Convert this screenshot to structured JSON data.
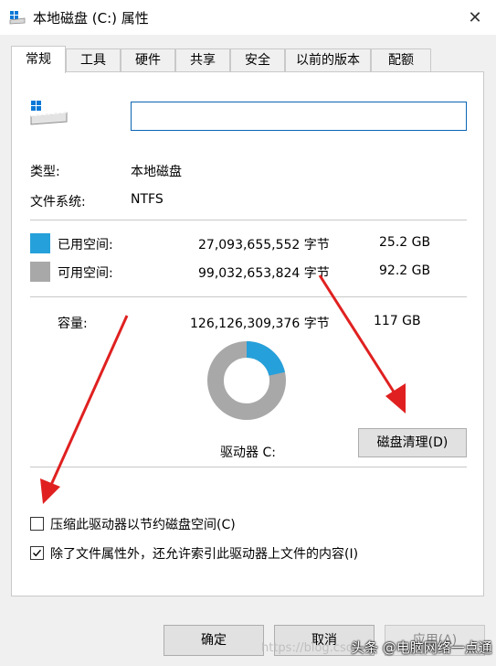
{
  "window": {
    "title": "本地磁盘 (C:) 属性",
    "close_symbol": "✕"
  },
  "tabs": [
    {
      "label": "常规",
      "active": true
    },
    {
      "label": "工具"
    },
    {
      "label": "硬件"
    },
    {
      "label": "共享"
    },
    {
      "label": "安全"
    },
    {
      "label": "以前的版本"
    },
    {
      "label": "配额"
    }
  ],
  "general": {
    "volume_name": "",
    "type_label": "类型:",
    "type_value": "本地磁盘",
    "fs_label": "文件系统:",
    "fs_value": "NTFS",
    "used": {
      "label": "已用空间:",
      "bytes": "27,093,655,552 字节",
      "size": "25.2 GB",
      "color": "#26a0da"
    },
    "free": {
      "label": "可用空间:",
      "bytes": "99,032,653,824 字节",
      "size": "92.2 GB",
      "color": "#a8a8a8"
    },
    "capacity": {
      "label": "容量:",
      "bytes": "126,126,309,376 字节",
      "size": "117 GB"
    },
    "used_fraction": 0.2148,
    "drive_label": "驱动器 C:",
    "cleanup_button": "磁盘清理(D)",
    "compress_label": "压缩此驱动器以节约磁盘空间(C)",
    "compress_checked": false,
    "index_label": "除了文件属性外，还允许索引此驱动器上文件的内容(I)",
    "index_checked": true
  },
  "buttons": {
    "ok": "确定",
    "cancel": "取消",
    "apply": "应用(A)"
  },
  "watermark": {
    "faint": "https://blog.csdn",
    "main": "头条 @电脑网络一点通"
  },
  "colors": {
    "accent_border": "#0a64b4",
    "arrow": "#e02020"
  },
  "icons": [
    "drive-title-icon",
    "close-icon",
    "hard-drive-icon",
    "check-icon",
    "red-arrow"
  ]
}
